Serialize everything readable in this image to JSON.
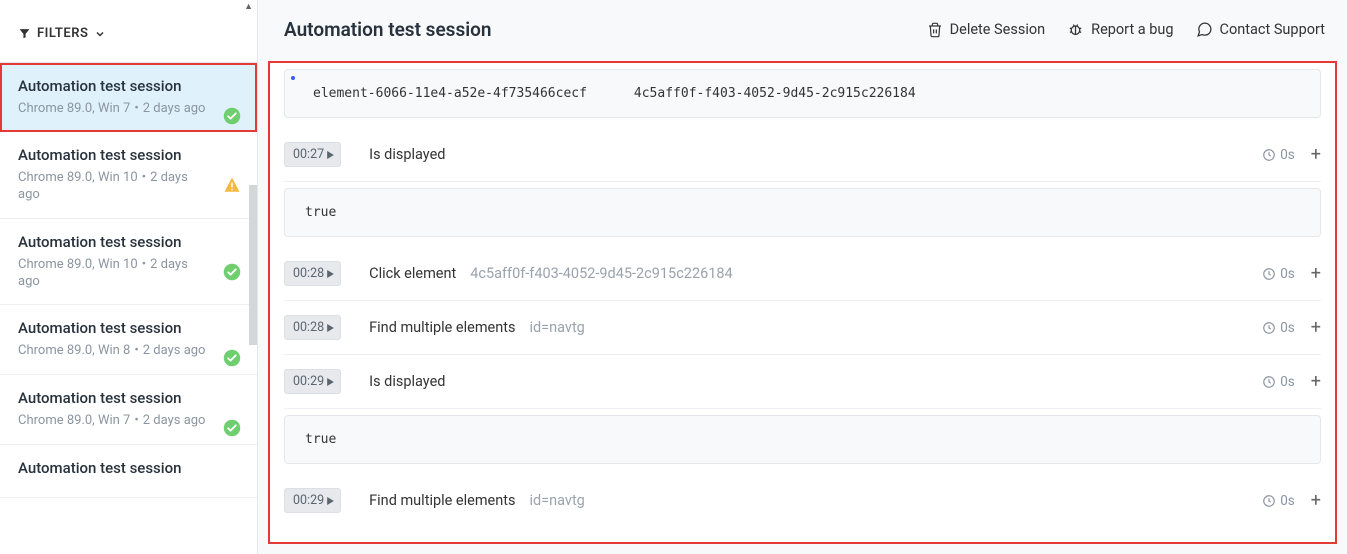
{
  "sidebar": {
    "filters_label": "FILTERS",
    "sessions": [
      {
        "title": "Automation test session",
        "browser": "Chrome 89.0, Win 7",
        "age": "2 days ago",
        "status": "success",
        "selected": true
      },
      {
        "title": "Automation test session",
        "browser": "Chrome 89.0, Win 10",
        "age": "2 days ago",
        "status": "warning",
        "selected": false
      },
      {
        "title": "Automation test session",
        "browser": "Chrome 89.0, Win 10",
        "age": "2 days ago",
        "status": "success",
        "selected": false
      },
      {
        "title": "Automation test session",
        "browser": "Chrome 89.0, Win 8",
        "age": "2 days ago",
        "status": "success",
        "selected": false
      },
      {
        "title": "Automation test session",
        "browser": "Chrome 89.0, Win 7",
        "age": "2 days ago",
        "status": "success",
        "selected": false
      },
      {
        "title": "Automation test session",
        "browser": "",
        "age": "",
        "status": "",
        "selected": false
      }
    ]
  },
  "header": {
    "title": "Automation test session",
    "actions": {
      "delete": "Delete Session",
      "report": "Report a bug",
      "contact": "Contact Support"
    }
  },
  "element_box": {
    "element": "element-6066-11e4-a52e-4f735466cecf",
    "value": "4c5aff0f-f403-4052-9d45-2c915c226184"
  },
  "logs": [
    {
      "time": "00:27",
      "action": "Is displayed",
      "detail": "",
      "duration": "0s",
      "result": "true"
    },
    {
      "time": "00:28",
      "action": "Click element",
      "detail": "4c5aff0f-f403-4052-9d45-2c915c226184",
      "duration": "0s",
      "result": null
    },
    {
      "time": "00:28",
      "action": "Find multiple elements",
      "detail": "id=navtg",
      "duration": "0s",
      "result": null
    },
    {
      "time": "00:29",
      "action": "Is displayed",
      "detail": "",
      "duration": "0s",
      "result": "true"
    },
    {
      "time": "00:29",
      "action": "Find multiple elements",
      "detail": "id=navtg",
      "duration": "0s",
      "result": null
    }
  ]
}
